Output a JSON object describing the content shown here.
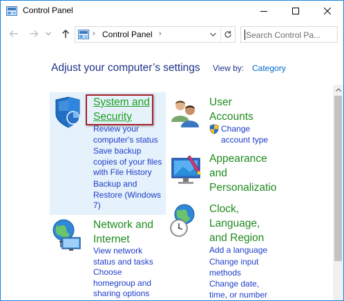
{
  "window": {
    "title": "Control Panel"
  },
  "address": {
    "path": "Control Panel",
    "search_placeholder": "Search Control Pa..."
  },
  "header": {
    "heading": "Adjust your computer’s settings",
    "view_by_label": "View by:",
    "view_by_value": "Category"
  },
  "categories": {
    "system": {
      "title_line1": "System and",
      "title_line2": "Security",
      "links": [
        [
          "Review your",
          "computer's status"
        ],
        [
          "Save backup",
          "copies of your files",
          "with File History"
        ],
        [
          "Backup and",
          "Restore (Windows",
          "7)"
        ]
      ]
    },
    "network": {
      "title_line1": "Network and",
      "title_line2": "Internet",
      "links": [
        [
          "View network",
          "status and tasks"
        ],
        [
          "Choose",
          "homegroup and",
          "sharing options"
        ]
      ]
    },
    "user": {
      "title_line1": "User",
      "title_line2": "Accounts",
      "links": [
        [
          "Change",
          "account type"
        ]
      ]
    },
    "appearance": {
      "title_line1": "Appearance",
      "title_line2": "and",
      "title_line3": "Personalizatio"
    },
    "clock": {
      "title_line1": "Clock,",
      "title_line2": "Language,",
      "title_line3": "and Region",
      "links": [
        [
          "Add a language"
        ],
        [
          "Change input",
          "methods"
        ],
        [
          "Change date,",
          "time, or number"
        ]
      ]
    }
  },
  "colors": {
    "category_title": "#1e8a1e",
    "link": "#1e3cc8",
    "heading": "#1e3287",
    "selection_bg": "#e5f1fb",
    "focus_border": "#a7222b"
  },
  "icons": {
    "app": "control-panel-icon",
    "system": "shield-icon",
    "network": "globe-network-icon",
    "user": "users-icon",
    "appearance": "monitor-paint-icon",
    "clock": "clock-globe-icon",
    "uac": "uac-shield-icon"
  }
}
